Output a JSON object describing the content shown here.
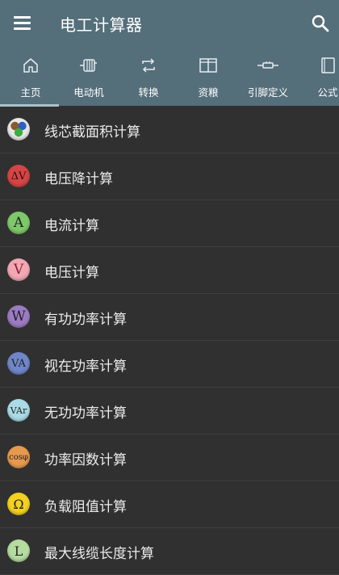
{
  "app": {
    "title": "电工计算器"
  },
  "tabs": [
    {
      "label": "主页",
      "icon": "home-icon"
    },
    {
      "label": "电动机",
      "icon": "motor-icon"
    },
    {
      "label": "转换",
      "icon": "repeat-icon"
    },
    {
      "label": "资粮",
      "icon": "book-open-icon"
    },
    {
      "label": "引脚定义",
      "icon": "connector-icon"
    },
    {
      "label": "公式",
      "icon": "book-icon"
    }
  ],
  "active_tab": "主页",
  "list": [
    {
      "label": "线芯截面积计算",
      "icon": "wire-cross-section-icon",
      "glyph": "",
      "color": "#e8e8e8"
    },
    {
      "label": "电压降计算",
      "icon": "voltage-drop-icon",
      "glyph": "ΔV",
      "color": "#d64545"
    },
    {
      "label": "电流计算",
      "icon": "current-icon",
      "glyph": "A",
      "color": "#7ec86a"
    },
    {
      "label": "电压计算",
      "icon": "voltage-icon",
      "glyph": "V",
      "color": "#f2a8b4"
    },
    {
      "label": "有功功率计算",
      "icon": "active-power-icon",
      "glyph": "W",
      "color": "#9b7cc4"
    },
    {
      "label": "视在功率计算",
      "icon": "apparent-power-icon",
      "glyph": "VA",
      "color": "#6f87c9"
    },
    {
      "label": "无功功率计算",
      "icon": "reactive-power-icon",
      "glyph": "VAr",
      "color": "#a9dbe6"
    },
    {
      "label": "功率因数计算",
      "icon": "power-factor-icon",
      "glyph": "cosφ",
      "color": "#e79a4e"
    },
    {
      "label": "负载阻值计算",
      "icon": "load-resistance-icon",
      "glyph": "Ω",
      "color": "#f3d21e"
    },
    {
      "label": "最大线缆长度计算",
      "icon": "max-cable-length-icon",
      "glyph": "L",
      "color": "#b5dca0"
    }
  ]
}
